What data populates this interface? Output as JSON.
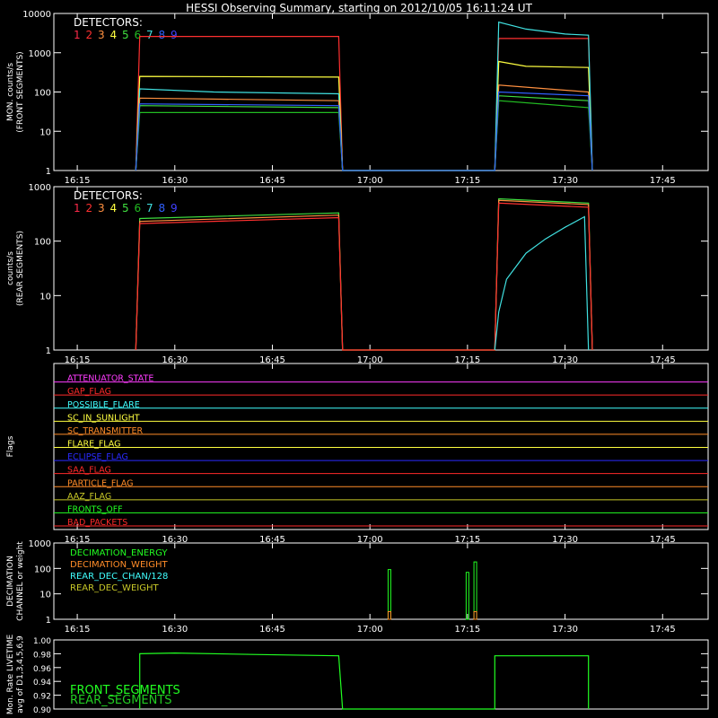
{
  "title": "HESSI Observing Summary, starting on 2012/10/05 16:11:24 UT",
  "colors": {
    "bg": "#000000",
    "axis": "#ffffff",
    "det": [
      "#ff2a4a",
      "#ff3030",
      "#ff9040",
      "#ffff40",
      "#40e040",
      "#22bb22",
      "#40e0e0",
      "#3060ff",
      "#4040ff"
    ],
    "yellow": "#ffff40",
    "cyan": "#40ffff",
    "green": "#22cc22",
    "orange": "#ff8c28",
    "red": "#ff2a2a",
    "magenta": "#ff3cff",
    "blue": "#2a2aff",
    "olive": "#c8c828",
    "bright_green": "#22ff22"
  },
  "chart_data": [
    {
      "type": "line",
      "panel": "front",
      "ylabel": "MON. counts/s\n(FRONT SEGMENTS)",
      "ylim": [
        1,
        10000
      ],
      "yscale": "log",
      "yticks": [
        "1",
        "10",
        "100",
        "1000",
        "10000"
      ],
      "xticks": [
        "16:15",
        "16:30",
        "16:45",
        "17:00",
        "17:15",
        "17:30",
        "17:45"
      ],
      "legend_title": "DETECTORS:",
      "legend": [
        "1",
        "2",
        "3",
        "4",
        "5",
        "6",
        "7",
        "8",
        "9"
      ],
      "series": [
        {
          "det": 2,
          "values": [
            [
              16.4,
              1
            ],
            [
              16.41,
              2600
            ],
            [
              16.92,
              2600
            ],
            [
              16.93,
              1
            ],
            [
              17.32,
              1
            ],
            [
              17.33,
              2300
            ],
            [
              17.56,
              2300
            ],
            [
              17.57,
              1
            ]
          ]
        },
        {
          "det": 4,
          "values": [
            [
              16.4,
              1
            ],
            [
              16.41,
              250
            ],
            [
              16.92,
              240
            ],
            [
              16.93,
              1
            ],
            [
              17.32,
              1
            ],
            [
              17.33,
              600
            ],
            [
              17.4,
              450
            ],
            [
              17.56,
              420
            ],
            [
              17.57,
              1
            ]
          ]
        },
        {
          "det": 7,
          "values": [
            [
              16.4,
              1
            ],
            [
              16.41,
              120
            ],
            [
              16.6,
              100
            ],
            [
              16.92,
              90
            ],
            [
              16.93,
              1
            ],
            [
              17.32,
              1
            ],
            [
              17.33,
              6000
            ],
            [
              17.4,
              4000
            ],
            [
              17.5,
              3000
            ],
            [
              17.56,
              2800
            ],
            [
              17.57,
              1
            ]
          ]
        },
        {
          "det": 3,
          "values": [
            [
              16.4,
              1
            ],
            [
              16.41,
              70
            ],
            [
              16.92,
              60
            ],
            [
              16.93,
              1
            ],
            [
              17.32,
              1
            ],
            [
              17.33,
              150
            ],
            [
              17.56,
              100
            ],
            [
              17.57,
              1
            ]
          ]
        },
        {
          "det": 5,
          "values": [
            [
              16.4,
              1
            ],
            [
              16.41,
              45
            ],
            [
              16.92,
              40
            ],
            [
              16.93,
              1
            ],
            [
              17.32,
              1
            ],
            [
              17.33,
              80
            ],
            [
              17.56,
              60
            ],
            [
              17.57,
              1
            ]
          ]
        },
        {
          "det": 6,
          "values": [
            [
              16.4,
              1
            ],
            [
              16.41,
              30
            ],
            [
              16.92,
              30
            ],
            [
              16.93,
              1
            ],
            [
              17.32,
              1
            ],
            [
              17.33,
              60
            ],
            [
              17.56,
              40
            ],
            [
              17.57,
              1
            ]
          ]
        },
        {
          "det": 8,
          "values": [
            [
              16.4,
              1
            ],
            [
              16.41,
              50
            ],
            [
              16.92,
              45
            ],
            [
              16.93,
              1
            ],
            [
              17.32,
              1
            ],
            [
              17.33,
              100
            ],
            [
              17.56,
              80
            ],
            [
              17.57,
              1
            ]
          ]
        }
      ]
    },
    {
      "type": "line",
      "panel": "rear",
      "ylabel": "counts/s\n(REAR SEGMENTS)",
      "ylim": [
        1,
        1000
      ],
      "yscale": "log",
      "yticks": [
        "1",
        "10",
        "100",
        "1000"
      ],
      "xticks": [
        "16:15",
        "16:30",
        "16:45",
        "17:00",
        "17:15",
        "17:30",
        "17:45"
      ],
      "legend_title": "DETECTORS:",
      "legend": [
        "1",
        "2",
        "3",
        "4",
        "5",
        "6",
        "7",
        "8",
        "9"
      ],
      "series": [
        {
          "det": 5,
          "values": [
            [
              16.4,
              1
            ],
            [
              16.41,
              260
            ],
            [
              16.92,
              330
            ],
            [
              16.93,
              1
            ],
            [
              17.32,
              1
            ],
            [
              17.33,
              600
            ],
            [
              17.56,
              500
            ],
            [
              17.57,
              1
            ]
          ]
        },
        {
          "det": 3,
          "values": [
            [
              16.4,
              1
            ],
            [
              16.41,
              230
            ],
            [
              16.92,
              300
            ],
            [
              16.93,
              1
            ],
            [
              17.32,
              1
            ],
            [
              17.33,
              560
            ],
            [
              17.56,
              470
            ],
            [
              17.57,
              1
            ]
          ]
        },
        {
          "det": 2,
          "values": [
            [
              16.4,
              1
            ],
            [
              16.41,
              210
            ],
            [
              16.92,
              270
            ],
            [
              16.93,
              1
            ],
            [
              17.32,
              1
            ],
            [
              17.33,
              500
            ],
            [
              17.56,
              420
            ],
            [
              17.57,
              1
            ]
          ]
        },
        {
          "det": 7,
          "values": [
            [
              17.32,
              1
            ],
            [
              17.33,
              5
            ],
            [
              17.35,
              20
            ],
            [
              17.4,
              60
            ],
            [
              17.45,
              110
            ],
            [
              17.5,
              180
            ],
            [
              17.55,
              280
            ],
            [
              17.56,
              1
            ]
          ]
        }
      ]
    },
    {
      "type": "line",
      "panel": "flags",
      "ylabel": "Flags",
      "xticks": [
        "16:15",
        "16:30",
        "16:45",
        "17:00",
        "17:15",
        "17:30",
        "17:45"
      ],
      "flags": [
        {
          "name": "ATTENUATOR_STATE",
          "color": "magenta"
        },
        {
          "name": "GAP_FLAG",
          "color": "red"
        },
        {
          "name": "POSSIBLE_FLARE",
          "color": "cyan"
        },
        {
          "name": "SC_IN_SUNLIGHT",
          "color": "yellow"
        },
        {
          "name": "SC_TRANSMITTER",
          "color": "orange"
        },
        {
          "name": "FLARE_FLAG",
          "color": "yellow"
        },
        {
          "name": "ECLIPSE_FLAG",
          "color": "blue"
        },
        {
          "name": "SAA_FLAG",
          "color": "red"
        },
        {
          "name": "PARTICLE_FLAG",
          "color": "orange"
        },
        {
          "name": "AAZ_FLAG",
          "color": "olive"
        },
        {
          "name": "FRONTS_OFF",
          "color": "bright_green"
        },
        {
          "name": "BAD_PACKETS",
          "color": "red"
        }
      ]
    },
    {
      "type": "bar",
      "panel": "decimation",
      "ylabel": "DECIMATION\nCHANNEL or weight",
      "ylim": [
        1,
        1000
      ],
      "yscale": "log",
      "yticks": [
        "1",
        "10",
        "100",
        "1000"
      ],
      "xticks": [
        "16:15",
        "16:30",
        "16:45",
        "17:00",
        "17:15",
        "17:30",
        "17:45"
      ],
      "legend": [
        {
          "name": "DECIMATION_ENERGY",
          "color": "bright_green"
        },
        {
          "name": "DECIMATION_WEIGHT",
          "color": "orange"
        },
        {
          "name": "REAR_DEC_CHAN/128",
          "color": "cyan"
        },
        {
          "name": "REAR_DEC_WEIGHT",
          "color": "olive"
        }
      ],
      "bars": [
        {
          "x": 17.05,
          "value": 90,
          "color": "bright_green"
        },
        {
          "x": 17.05,
          "value": 2,
          "color": "orange"
        },
        {
          "x": 17.25,
          "value": 70,
          "color": "bright_green"
        },
        {
          "x": 17.27,
          "value": 180,
          "color": "bright_green"
        },
        {
          "x": 17.27,
          "value": 2,
          "color": "orange"
        }
      ]
    },
    {
      "type": "line",
      "panel": "livetime",
      "ylabel": "Mon. Rate LIVETIME\navg of D1,3,4,5,6,9",
      "ylim": [
        0.9,
        1.0
      ],
      "yticks": [
        "0.90",
        "0.92",
        "0.94",
        "0.96",
        "0.98",
        "1.00"
      ],
      "legend": [
        {
          "name": "FRONT_SEGMENTS",
          "color": "bright_green"
        },
        {
          "name": "REAR_SEGMENTS",
          "color": "green"
        }
      ],
      "series": [
        {
          "name": "FRONT_SEGMENTS",
          "values": [
            [
              16.41,
              0.9
            ],
            [
              16.41,
              0.98
            ],
            [
              16.5,
              0.981
            ],
            [
              16.7,
              0.979
            ],
            [
              16.92,
              0.977
            ],
            [
              16.93,
              0.9
            ],
            [
              17.32,
              0.9
            ],
            [
              17.32,
              0.977
            ],
            [
              17.56,
              0.977
            ],
            [
              17.56,
              0.9
            ]
          ]
        }
      ]
    }
  ]
}
